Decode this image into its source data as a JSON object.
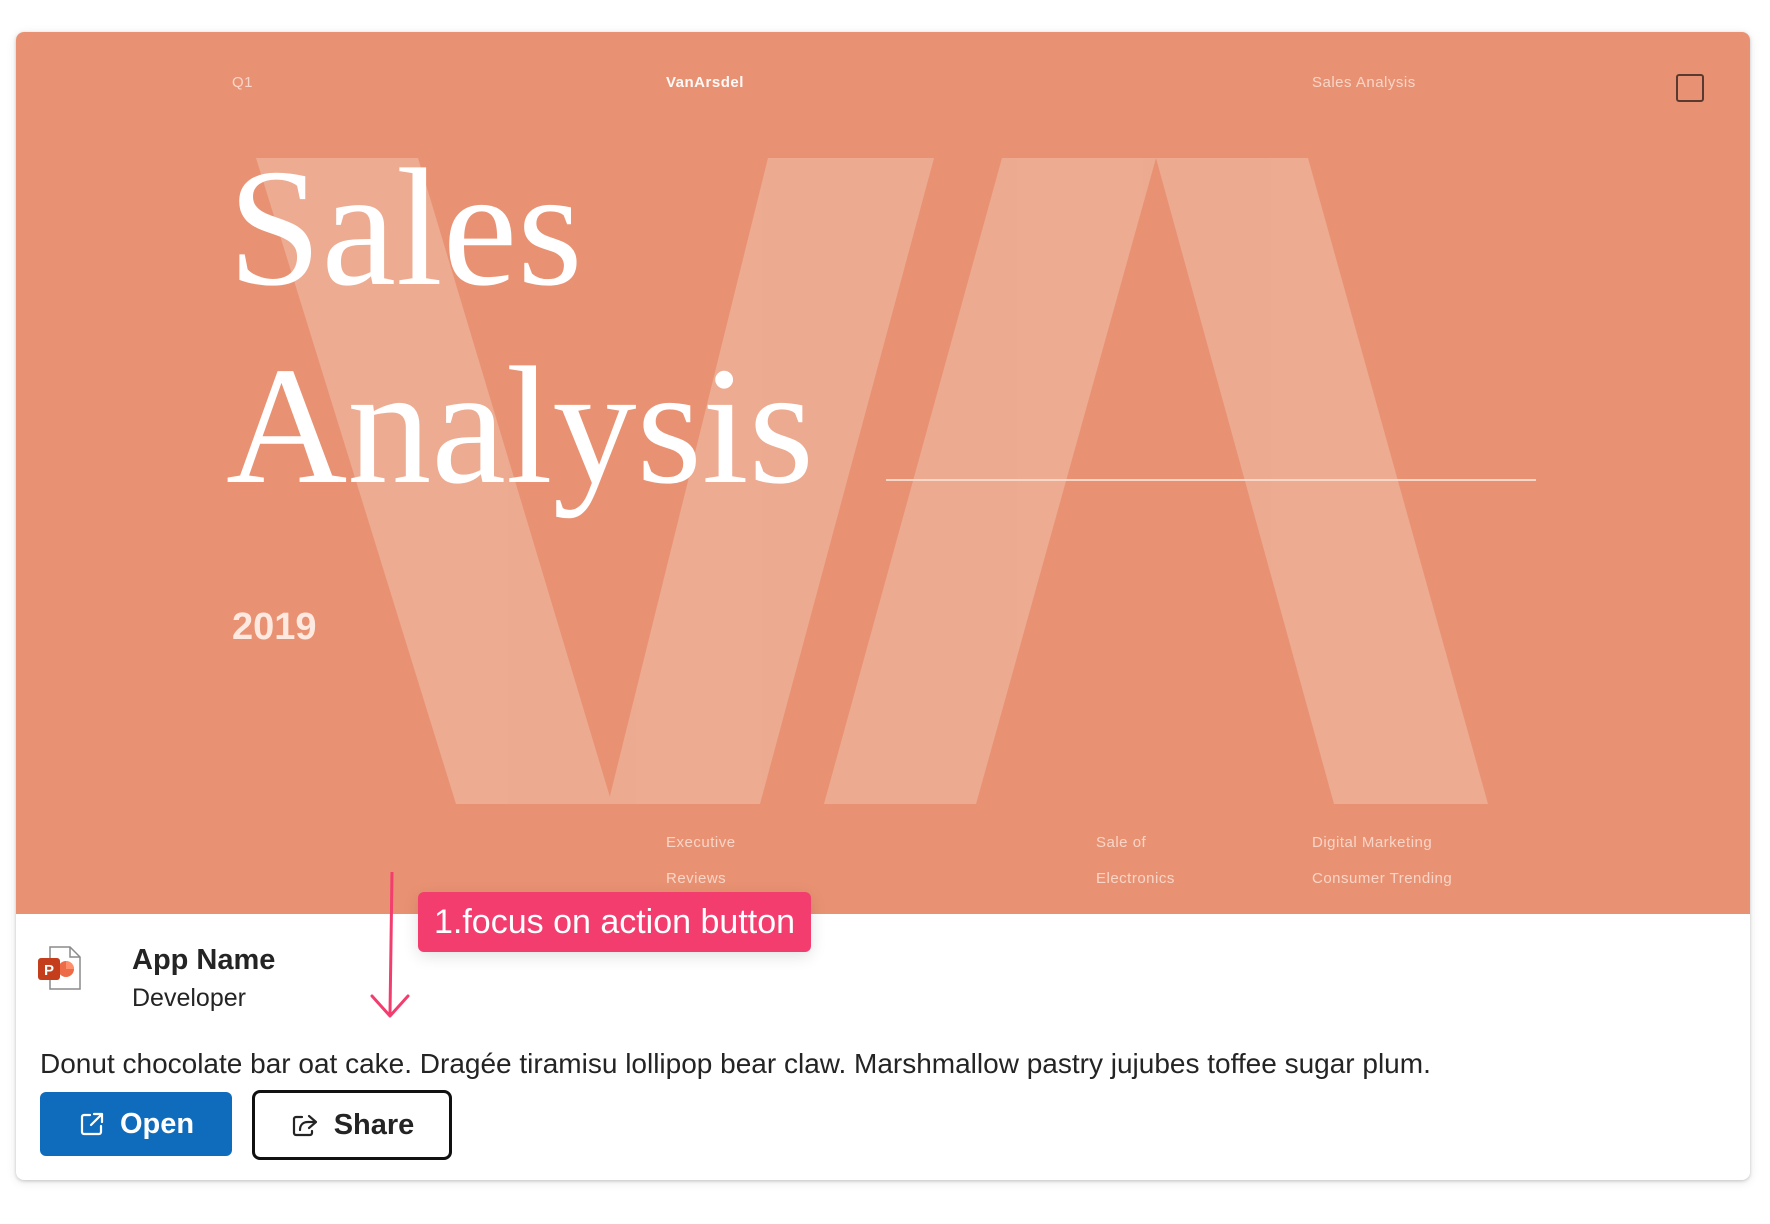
{
  "hero": {
    "quarter_label": "Q1",
    "brand": "VanArsdel",
    "slide_title_label": "Sales Analysis",
    "title_line1": "Sales",
    "title_line2": "Analysis",
    "year": "2019",
    "monogram": "VA",
    "footer": {
      "col1_line1": "Executive",
      "col1_line2": "Reviews",
      "col2_line1": "Sale of",
      "col2_line2": "Electronics",
      "col3_line1": "Digital Marketing",
      "col3_line2": "Consumer Trending"
    },
    "background_color": "#e99273"
  },
  "app": {
    "name": "App Name",
    "developer": "Developer",
    "icon": "powerpoint-icon"
  },
  "description": "Donut chocolate bar oat cake. Dragée tiramisu lollipop bear claw. Marshmallow pastry jujubes toffee sugar plum.",
  "actions": {
    "open_label": "Open",
    "open_icon": "open-external-icon",
    "share_label": "Share",
    "share_icon": "share-icon",
    "primary_color": "#0f6cbd"
  },
  "annotation": {
    "text": "1.focus on action button",
    "color": "#f23d6e"
  }
}
